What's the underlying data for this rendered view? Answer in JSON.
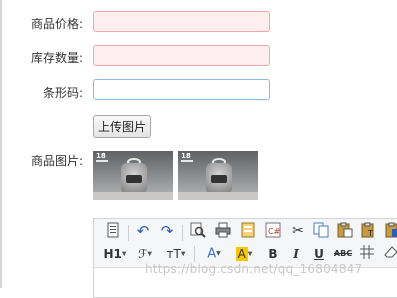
{
  "form": {
    "price_label": "商品价格:",
    "stock_label": "库存数量:",
    "barcode_label": "条形码:",
    "upload_button": "上传图片",
    "images_label": "商品图片:",
    "price_value": "",
    "stock_value": "",
    "barcode_value": ""
  },
  "images": [
    {
      "name": "product-image-1",
      "brand": "18"
    },
    {
      "name": "product-image-2",
      "brand": "18"
    }
  ],
  "toolbar": {
    "heading": "H1",
    "font": "ℱ",
    "fontsize": "тT",
    "bold": "B",
    "italic": "I",
    "underline": "U",
    "strike": "ABC"
  },
  "watermark": "https://blog.csdn.net/qq_16804847",
  "colors": {
    "invalid_border": "#f0a8a8",
    "invalid_bg": "#ffeef0",
    "valid_border": "#8fb7e0",
    "highlight": "#f7c600",
    "font_color": "#3d6fd6"
  }
}
